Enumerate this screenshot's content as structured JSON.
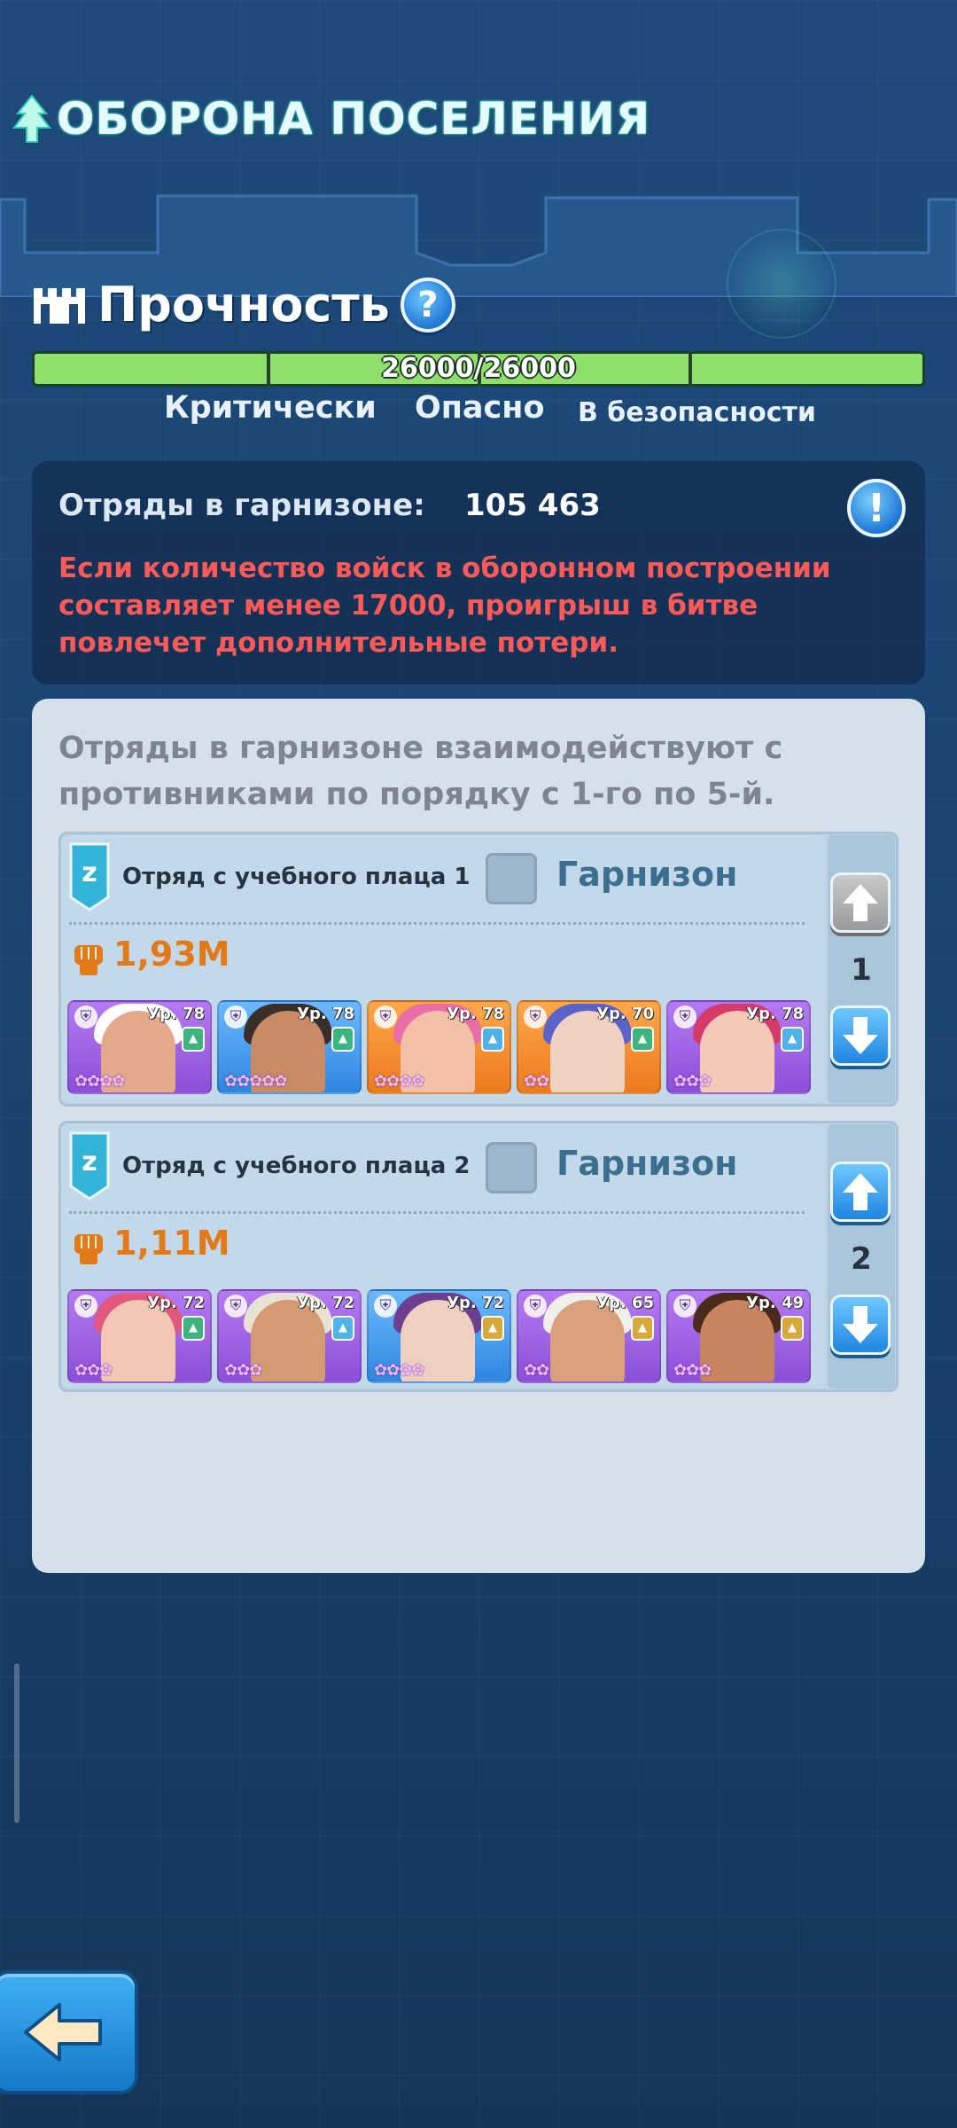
{
  "header": {
    "title": "ОБОРОНА ПОСЕЛЕНИЯ",
    "tree_icon": "pine-tree-icon"
  },
  "durability": {
    "label": "Прочность",
    "current": 26000,
    "max": 26000,
    "bar_text": "26000/26000",
    "fill_fraction": 1.0,
    "zones": [
      "Критически",
      "Опасно",
      "В безопасности"
    ],
    "bar_color": "#8ee06a"
  },
  "garrison": {
    "label": "Отряды в гарнизоне:",
    "value": "105 463",
    "warning": "Если количество войск в оборонном построении составляет менее 17000, проигрыш в битве повлечет дополнительные потери.",
    "warning_color": "#ff5a58"
  },
  "squads_panel": {
    "intro": "Отряды в гарнизоне взаимодействуют с противниками по порядку с 1-го по 5-й.",
    "squads": [
      {
        "name": "Отряд с учебного плаца 1",
        "tag": "Гарнизон",
        "power": "1,93M",
        "order": "1",
        "up_enabled": false,
        "heroes": [
          {
            "level": "Ур. 78",
            "bg": "purple",
            "skin": "#e4a98a",
            "hair": "#ffffff",
            "elem": "green",
            "stars": "✿✿✿✿"
          },
          {
            "level": "Ур. 78",
            "bg": "blue",
            "skin": "#c98b65",
            "hair": "#3a2e2a",
            "elem": "green",
            "stars": "✿✿✿✿✿"
          },
          {
            "level": "Ур. 78",
            "bg": "orange",
            "skin": "#f2c1a5",
            "hair": "#e96ea8",
            "elem": "blue",
            "stars": "✿✿✿✿"
          },
          {
            "level": "Ур. 70",
            "bg": "orange",
            "skin": "#efd0c2",
            "hair": "#5a63c8",
            "elem": "green",
            "stars": "✿✿"
          },
          {
            "level": "Ур. 78",
            "bg": "purple",
            "skin": "#f5c9b4",
            "hair": "#d63a6a",
            "elem": "blue",
            "stars": "✿✿✿"
          }
        ]
      },
      {
        "name": "Отряд с учебного плаца 2",
        "tag": "Гарнизон",
        "power": "1,11M",
        "order": "2",
        "up_enabled": true,
        "heroes": [
          {
            "level": "Ур. 72",
            "bg": "purple",
            "skin": "#f3c7b1",
            "hair": "#e2587f",
            "elem": "green",
            "stars": "✿✿✿"
          },
          {
            "level": "Ур. 72",
            "bg": "purple",
            "skin": "#d49a72",
            "hair": "#e8e2d2",
            "elem": "blue",
            "stars": "✿✿✿"
          },
          {
            "level": "Ур. 72",
            "bg": "blue",
            "skin": "#efcfbf",
            "hair": "#6c3f8f",
            "elem": "gold",
            "stars": "✿✿✿✿"
          },
          {
            "level": "Ур. 65",
            "bg": "purple",
            "skin": "#d9a07c",
            "hair": "#f0efea",
            "elem": "gold",
            "stars": "✿✿"
          },
          {
            "level": "Ур. 49",
            "bg": "purple",
            "skin": "#c8845e",
            "hair": "#4a2a1c",
            "elem": "gold",
            "stars": "✿✿✿"
          }
        ]
      }
    ]
  },
  "icons": {
    "help": "?",
    "alert": "!",
    "back": "back-arrow-icon"
  }
}
